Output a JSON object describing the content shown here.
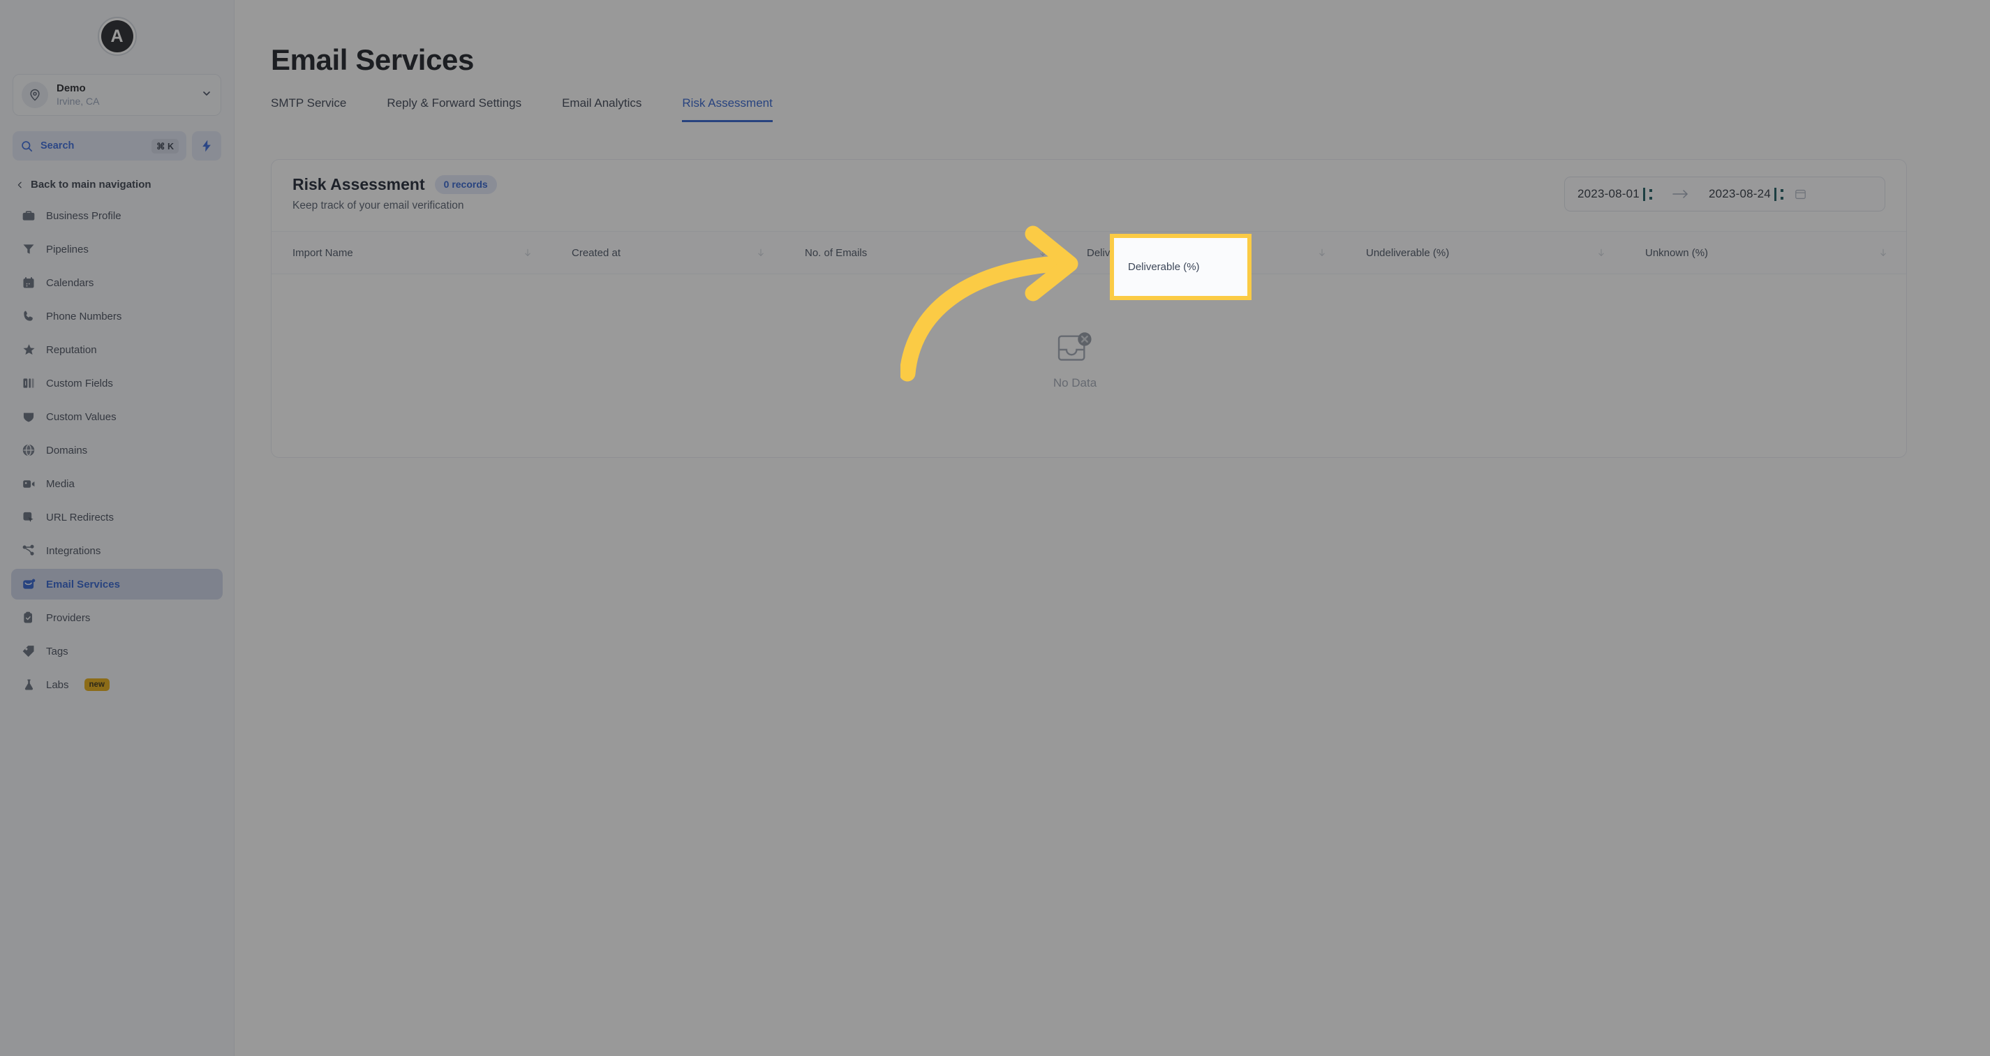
{
  "sidebar": {
    "logo_letter": "A",
    "location": {
      "name": "Demo",
      "sub": "Irvine, CA",
      "avatar_icon": "location-pin-icon",
      "chevron_icon": "chevron-down-icon"
    },
    "search": {
      "label": "Search",
      "shortcut": "⌘ K",
      "icon": "search-icon"
    },
    "quick_action_icon": "lightning-bolt-icon",
    "back_label": "Back to main navigation",
    "back_icon": "chevron-left-icon",
    "items": [
      {
        "label": "Business Profile",
        "icon": "briefcase-icon",
        "active": false
      },
      {
        "label": "Pipelines",
        "icon": "funnel-icon",
        "active": false
      },
      {
        "label": "Calendars",
        "icon": "calendar-icon",
        "active": false
      },
      {
        "label": "Phone Numbers",
        "icon": "phone-icon",
        "active": false
      },
      {
        "label": "Reputation",
        "icon": "star-icon",
        "active": false
      },
      {
        "label": "Custom Fields",
        "icon": "columns-icon",
        "active": false
      },
      {
        "label": "Custom Values",
        "icon": "shield-icon",
        "active": false
      },
      {
        "label": "Domains",
        "icon": "globe-icon",
        "active": false
      },
      {
        "label": "Media",
        "icon": "video-icon",
        "active": false
      },
      {
        "label": "URL Redirects",
        "icon": "cursor-box-icon",
        "active": false
      },
      {
        "label": "Integrations",
        "icon": "nodes-icon",
        "active": false
      },
      {
        "label": "Email Services",
        "icon": "envelope-icon",
        "active": true
      },
      {
        "label": "Providers",
        "icon": "clipboard-check-icon",
        "active": false
      },
      {
        "label": "Tags",
        "icon": "tag-icon",
        "active": false
      },
      {
        "label": "Labs",
        "icon": "flask-icon",
        "active": false,
        "badge": "new"
      }
    ]
  },
  "header": {
    "title": "Email Services"
  },
  "tabs": [
    {
      "label": "SMTP Service",
      "active": false
    },
    {
      "label": "Reply & Forward Settings",
      "active": false
    },
    {
      "label": "Email Analytics",
      "active": false
    },
    {
      "label": "Risk Assessment",
      "active": true
    }
  ],
  "card": {
    "title": "Risk Assessment",
    "records_pill": "0 records",
    "subtitle": "Keep track of your email verification",
    "date_range": {
      "start": "2023-08-01",
      "end": "2023-08-24",
      "arrow_icon": "arrow-right-icon",
      "calendar_icon": "calendar-icon"
    },
    "columns": [
      {
        "label": "Import Name",
        "sortable": true
      },
      {
        "label": "Created at",
        "sortable": true
      },
      {
        "label": "No. of Emails",
        "sortable": true
      },
      {
        "label": "Deliverable (%)",
        "sortable": true
      },
      {
        "label": "Undeliverable (%)",
        "sortable": true
      },
      {
        "label": "Unknown (%)",
        "sortable": true
      }
    ],
    "empty_state": {
      "label": "No Data",
      "icon": "inbox-x-icon"
    }
  },
  "annotation": {
    "highlighted_column": "Deliverable (%)",
    "arrow_icon": "curved-arrow-icon",
    "highlight_color": "#fbcb45"
  },
  "colors": {
    "accent_blue": "#2357c9",
    "highlight_yellow": "#fbcb45",
    "badge_amber": "#e2a505",
    "dim_overlay": "rgba(46,46,46,0.48)"
  }
}
